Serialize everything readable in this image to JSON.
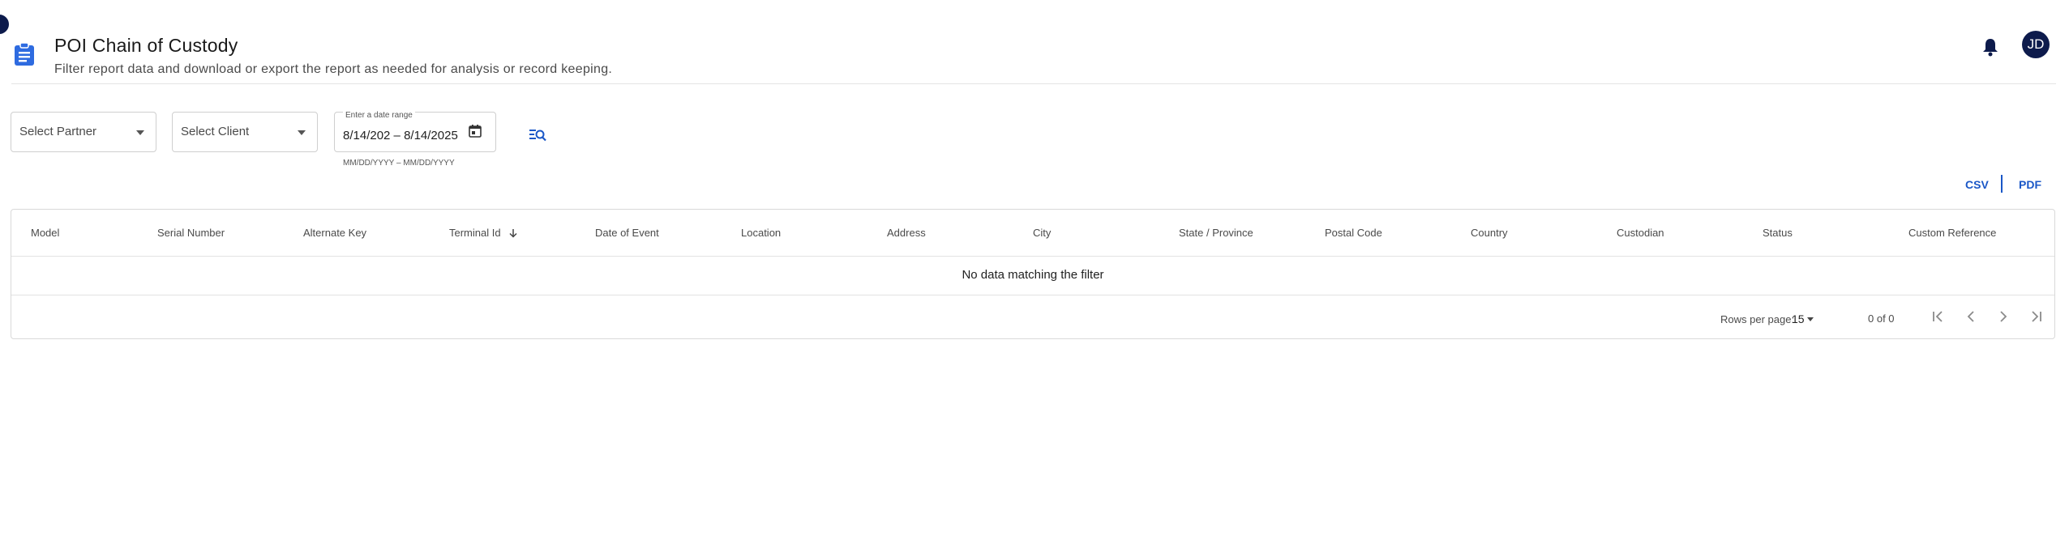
{
  "header": {
    "title": "POI Chain of Custody",
    "subtitle": "Filter report data and download or export the report as needed for analysis or record keeping.",
    "avatar_initials": "JD"
  },
  "filters": {
    "partner_placeholder": "Select Partner",
    "client_placeholder": "Select Client",
    "date_label": "Enter a date range",
    "date_value": "8/14/202 – 8/14/2025",
    "date_hint": "MM/DD/YYYY – MM/DD/YYYY"
  },
  "export": {
    "csv_label": "CSV",
    "pdf_label": "PDF"
  },
  "table": {
    "columns": [
      "Model",
      "Serial Number",
      "Alternate Key",
      "Terminal Id",
      "Date of Event",
      "Location",
      "Address",
      "City",
      "State / Province",
      "Postal Code",
      "Country",
      "Custodian",
      "Status",
      "Custom Reference"
    ],
    "sorted_column": "Terminal Id",
    "empty_message": "No data matching the filter",
    "rows_per_page_label": "Rows per page:",
    "rows_per_page": "15",
    "range_text": "0 of 0"
  },
  "colors": {
    "accent": "#1a57c7",
    "avatar_bg": "#0d1b4c",
    "header_icon": "#2e6be0"
  },
  "icons": {
    "header": "clipboard-icon",
    "notifications": "bell-icon",
    "date": "calendar-icon",
    "search": "filter-search-icon",
    "sort": "arrow-down-icon",
    "first": "first-page-icon",
    "prev": "chevron-left-icon",
    "next": "chevron-right-icon",
    "last": "last-page-icon"
  }
}
